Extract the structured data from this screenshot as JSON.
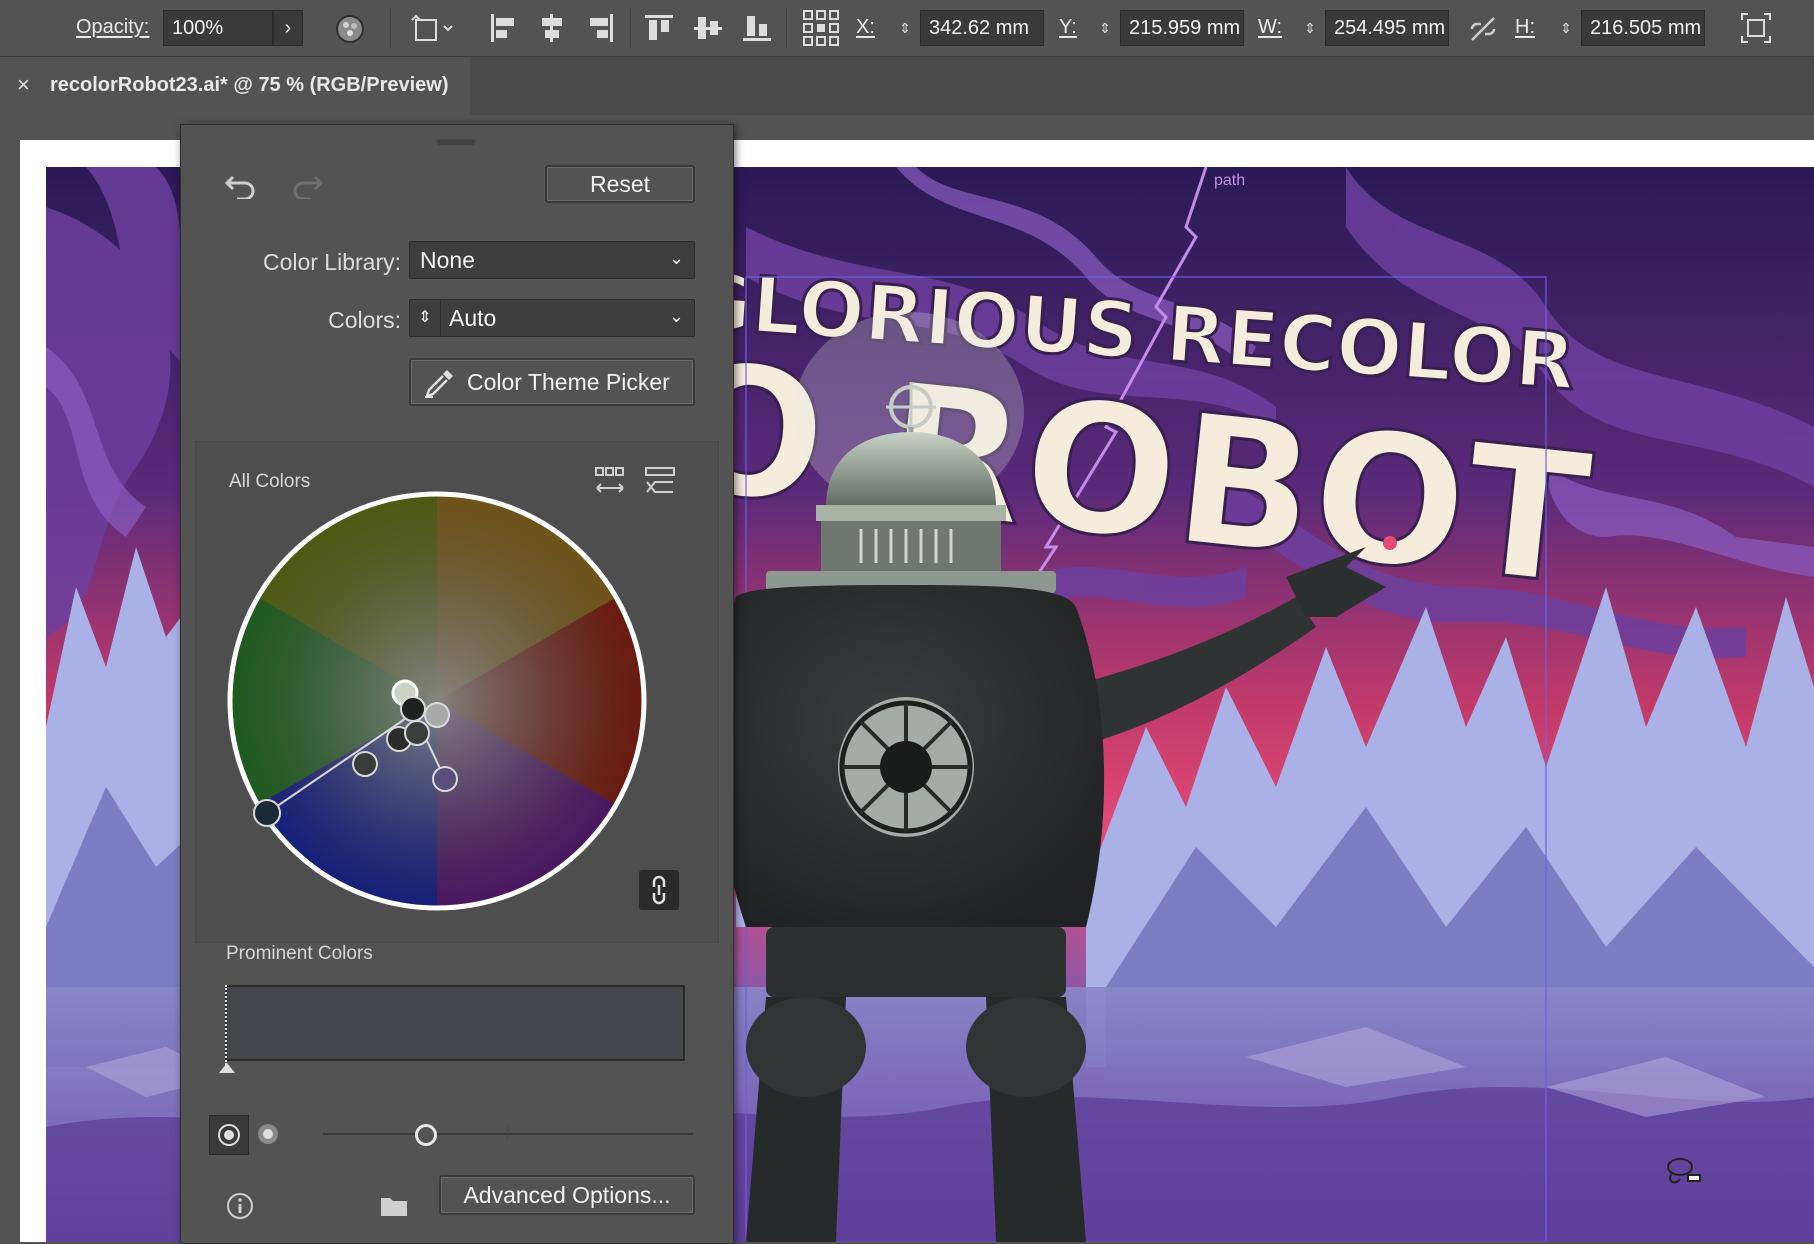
{
  "control_bar": {
    "opacity_label": "Opacity:",
    "opacity_value": "100%",
    "x_label": "X:",
    "x_value": "342.62 mm",
    "y_label": "Y:",
    "y_value": "215.959 mm",
    "w_label": "W:",
    "w_value": "254.495 mm",
    "h_label": "H:",
    "h_value": "216.505 mm"
  },
  "document_tab": {
    "close": "×",
    "title": "recolorRobot23.ai* @ 75 % (RGB/Preview)"
  },
  "artwork": {
    "headline_line1": "GLORIOUS RECOLOR",
    "headline_line2_partial": "O",
    "headline_line2": "ROBOT",
    "path_label": "path"
  },
  "recolor_panel": {
    "reset_label": "Reset",
    "color_library_label": "Color Library:",
    "color_library_value": "None",
    "colors_label": "Colors:",
    "colors_value": "Auto",
    "theme_picker_label": "Color Theme Picker",
    "all_colors_label": "All Colors",
    "prominent_colors_label": "Prominent Colors",
    "advanced_options_label": "Advanced Options..."
  },
  "colors": {
    "ui_bg": "#535353",
    "panel_dark": "#3e3e3e",
    "poster_purple": "#4a2a7a",
    "poster_pink": "#d6406e",
    "title_cream": "#f5ecdc",
    "robot_dark": "#2a2d2d"
  }
}
